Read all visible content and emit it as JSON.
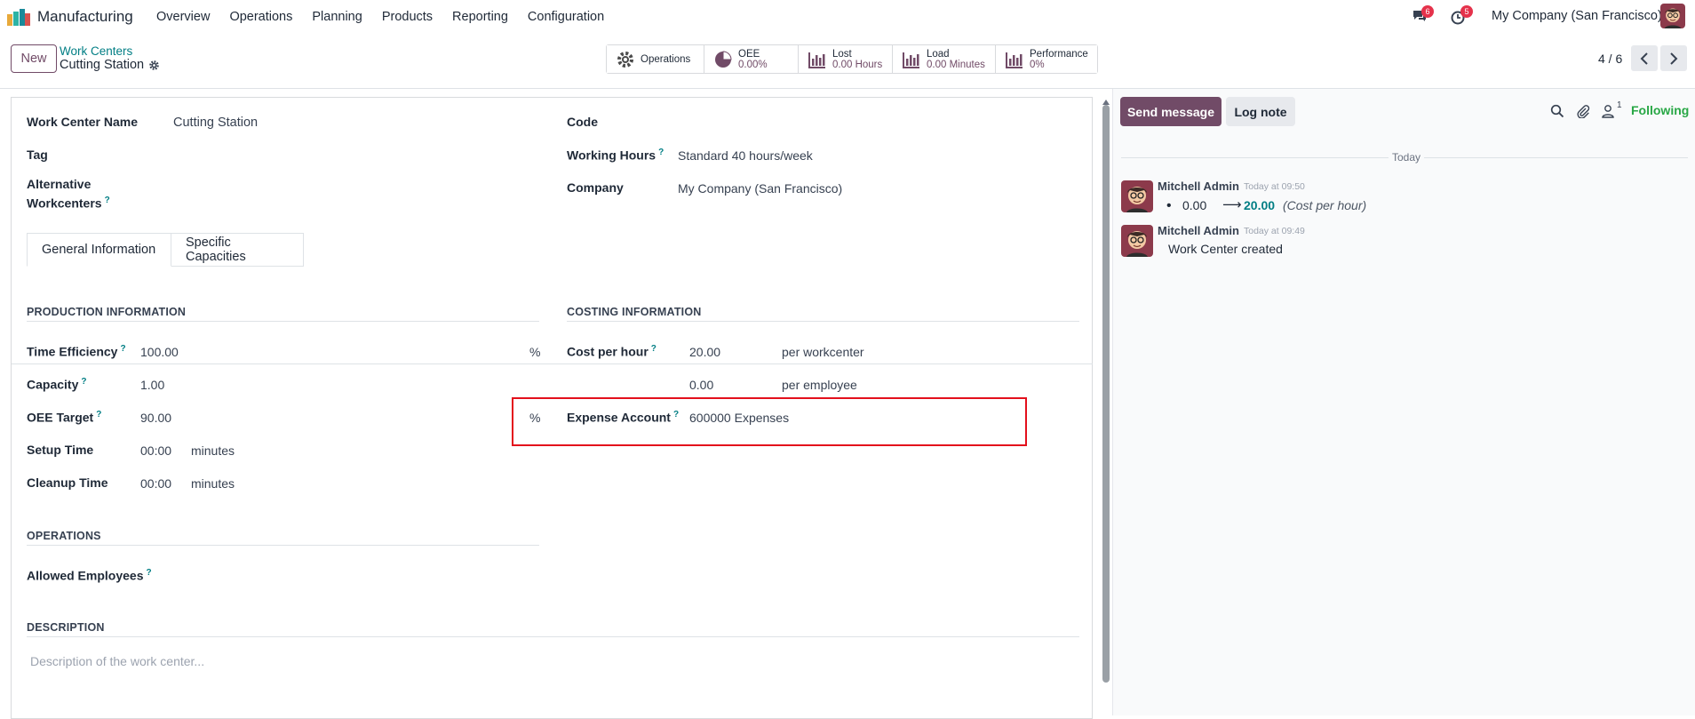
{
  "topbar": {
    "app_name": "Manufacturing",
    "menu": [
      "Overview",
      "Operations",
      "Planning",
      "Products",
      "Reporting",
      "Configuration"
    ],
    "messages_count": "6",
    "activities_count": "5",
    "company": "My Company (San Francisco)"
  },
  "control": {
    "new_label": "New",
    "breadcrumb_parent": "Work Centers",
    "record_title": "Cutting Station",
    "pager": "4 / 6"
  },
  "stats": [
    {
      "label": "Operations",
      "value": ""
    },
    {
      "label": "OEE",
      "value": "0.00%"
    },
    {
      "label": "Lost",
      "value": "0.00 Hours"
    },
    {
      "label": "Load",
      "value": "0.00 Minutes"
    },
    {
      "label": "Performance",
      "value": "0%"
    }
  ],
  "form": {
    "name_label": "Work Center Name",
    "name_value": "Cutting Station",
    "tag_label": "Tag",
    "alt_label_1": "Alternative",
    "alt_label_2": "Workcenters",
    "code_label": "Code",
    "hours_label": "Working Hours",
    "hours_value": "Standard 40 hours/week",
    "company_label": "Company",
    "company_value": "My Company (San Francisco)",
    "help_mark": "?"
  },
  "tabs": [
    "General Information",
    "Specific Capacities"
  ],
  "production": {
    "title": "PRODUCTION INFORMATION",
    "time_eff_label": "Time Efficiency",
    "time_eff_value": "100.00",
    "time_eff_unit": "%",
    "capacity_label": "Capacity",
    "capacity_value": "1.00",
    "oee_label": "OEE Target",
    "oee_value": "90.00",
    "oee_unit": "%",
    "setup_label": "Setup Time",
    "setup_value": "00:00",
    "setup_unit": "minutes",
    "cleanup_label": "Cleanup Time",
    "cleanup_value": "00:00",
    "cleanup_unit": "minutes"
  },
  "costing": {
    "title": "COSTING INFORMATION",
    "cost_label": "Cost per hour",
    "cost_value": "20.00",
    "cost_unit": "per workcenter",
    "emp_value": "0.00",
    "emp_unit": "per employee",
    "expense_label": "Expense Account",
    "expense_value": "600000 Expenses"
  },
  "operations": {
    "title": "OPERATIONS",
    "allowed_label": "Allowed Employees"
  },
  "description": {
    "title": "DESCRIPTION",
    "placeholder": "Description of the work center..."
  },
  "chatter": {
    "send_label": "Send message",
    "log_label": "Log note",
    "followers_count": "1",
    "following_label": "Following",
    "day_label": "Today",
    "messages": [
      {
        "author": "Mitchell Admin",
        "time": "Today at 09:50",
        "old": "0.00",
        "new": "20.00",
        "field": "(Cost per hour)"
      },
      {
        "author": "Mitchell Admin",
        "time": "Today at 09:49",
        "text": "Work Center created"
      }
    ]
  },
  "colors": {
    "brand": "#714b67",
    "link": "#017e84",
    "following": "#28a745",
    "highlight": "#e3101c"
  }
}
